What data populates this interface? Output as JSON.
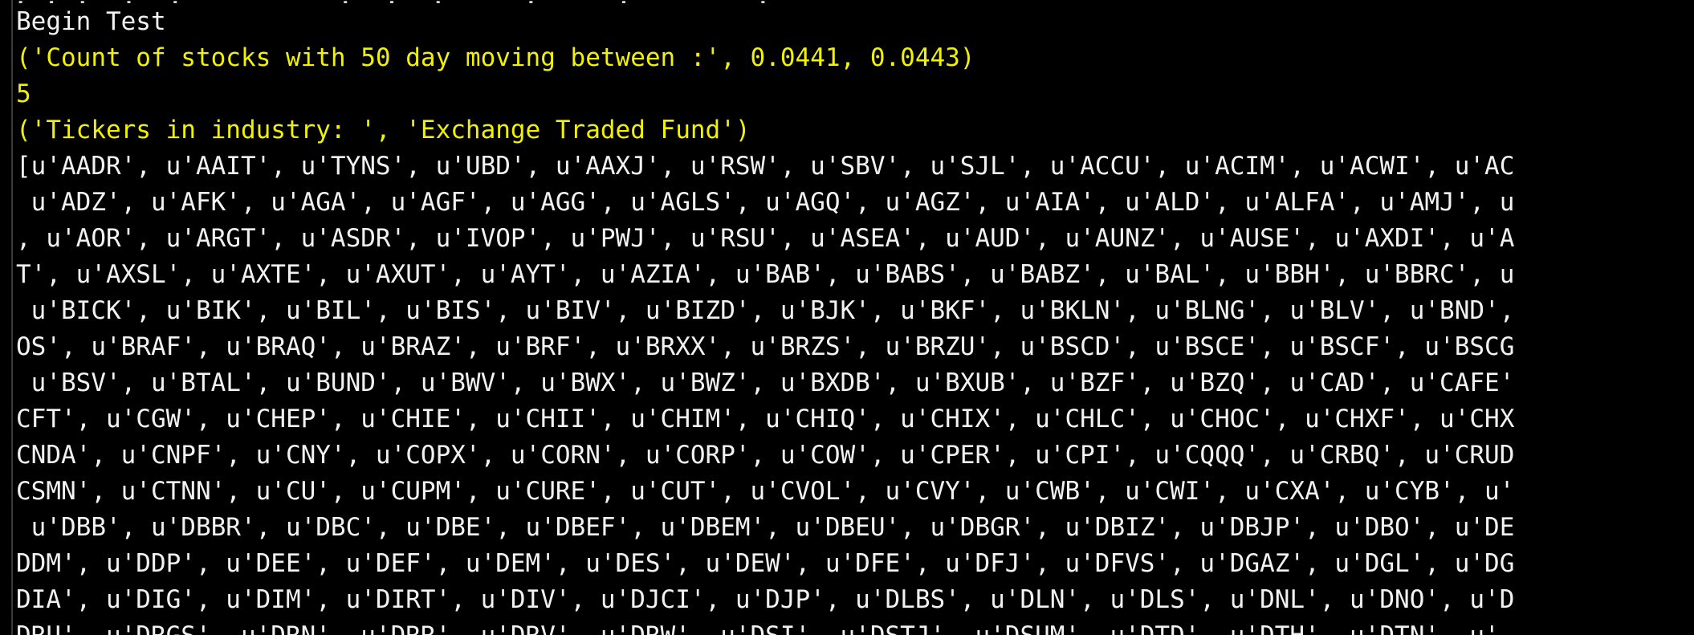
{
  "terminal": {
    "clipped_top_line": ". . .  .  .          .  .  .     .     .        .",
    "lines": [
      {
        "text": "Begin Test",
        "color": "white"
      },
      {
        "text": "('Count of stocks with 50 day moving between :', 0.0441, 0.0443)",
        "color": "yellow"
      },
      {
        "text": "5",
        "color": "yellow"
      },
      {
        "text": "('Tickers in industry: ', 'Exchange Traded Fund')",
        "color": "yellow"
      },
      {
        "text": "[u'AADR', u'AAIT', u'TYNS', u'UBD', u'AAXJ', u'RSW', u'SBV', u'SJL', u'ACCU', u'ACIM', u'ACWI', u'AC",
        "color": "white"
      },
      {
        "text": " u'ADZ', u'AFK', u'AGA', u'AGF', u'AGG', u'AGLS', u'AGQ', u'AGZ', u'AIA', u'ALD', u'ALFA', u'AMJ', u",
        "color": "white"
      },
      {
        "text": ", u'AOR', u'ARGT', u'ASDR', u'IVOP', u'PWJ', u'RSU', u'ASEA', u'AUD', u'AUNZ', u'AUSE', u'AXDI', u'A",
        "color": "white"
      },
      {
        "text": "T', u'AXSL', u'AXTE', u'AXUT', u'AYT', u'AZIA', u'BAB', u'BABS', u'BABZ', u'BAL', u'BBH', u'BBRC', u",
        "color": "white"
      },
      {
        "text": " u'BICK', u'BIK', u'BIL', u'BIS', u'BIV', u'BIZD', u'BJK', u'BKF', u'BKLN', u'BLNG', u'BLV', u'BND',",
        "color": "white"
      },
      {
        "text": "OS', u'BRAF', u'BRAQ', u'BRAZ', u'BRF', u'BRXX', u'BRZS', u'BRZU', u'BSCD', u'BSCE', u'BSCF', u'BSCG",
        "color": "white"
      },
      {
        "text": " u'BSV', u'BTAL', u'BUND', u'BWV', u'BWX', u'BWZ', u'BXDB', u'BXUB', u'BZF', u'BZQ', u'CAD', u'CAFE'",
        "color": "white"
      },
      {
        "text": "CFT', u'CGW', u'CHEP', u'CHIE', u'CHII', u'CHIM', u'CHIQ', u'CHIX', u'CHLC', u'CHOC', u'CHXF', u'CHX",
        "color": "white"
      },
      {
        "text": "CNDA', u'CNPF', u'CNY', u'COPX', u'CORN', u'CORP', u'COW', u'CPER', u'CPI', u'CQQQ', u'CRBQ', u'CRUD",
        "color": "white"
      },
      {
        "text": "CSMN', u'CTNN', u'CU', u'CUPM', u'CURE', u'CUT', u'CVOL', u'CVY', u'CWB', u'CWI', u'CXA', u'CYB', u'",
        "color": "white"
      },
      {
        "text": " u'DBB', u'DBBR', u'DBC', u'DBE', u'DBEF', u'DBEM', u'DBEU', u'DBGR', u'DBIZ', u'DBJP', u'DBO', u'DE",
        "color": "white"
      },
      {
        "text": "DDM', u'DDP', u'DEE', u'DEF', u'DEM', u'DES', u'DEW', u'DFE', u'DFJ', u'DFVS', u'DGAZ', u'DGL', u'DG",
        "color": "white"
      },
      {
        "text": "DIA', u'DIG', u'DIM', u'DIRT', u'DIV', u'DJCI', u'DJP', u'DLBS', u'DLN', u'DLS', u'DNL', u'DNO', u'D",
        "color": "white"
      },
      {
        "text": "DRU', u'DRGS', u'DRN', u'DRR', u'DRV', u'DRW', u'DSI', u'DSTJ', u'DSUM', u'DTD', u'DTH', u'DTN', u'",
        "color": "white"
      }
    ]
  }
}
